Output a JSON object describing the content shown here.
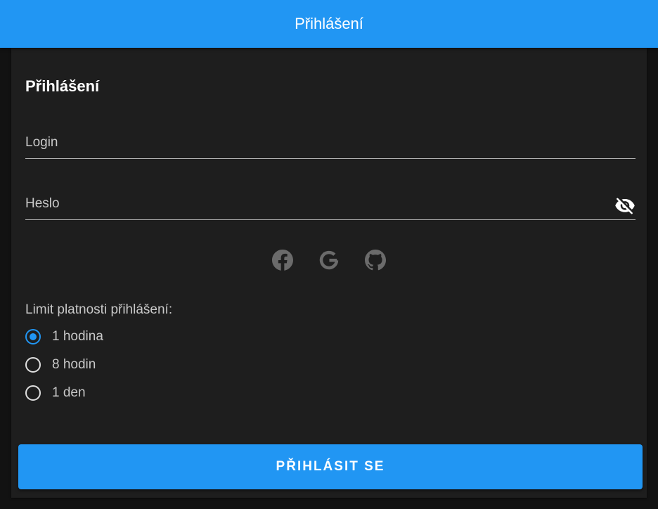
{
  "appbar": {
    "title": "Přihlášení"
  },
  "form": {
    "heading": "Přihlášení",
    "login": {
      "label": "Login",
      "value": ""
    },
    "password": {
      "label": "Heslo",
      "value": "",
      "toggle_icon": "eye-off-icon"
    },
    "social": [
      {
        "name": "facebook",
        "icon": "facebook-icon"
      },
      {
        "name": "google",
        "icon": "google-icon"
      },
      {
        "name": "github",
        "icon": "github-icon"
      }
    ],
    "limit": {
      "label": "Limit platnosti přihlášení:",
      "options": [
        "1 hodina",
        "8 hodin",
        "1 den"
      ],
      "selected": "1 hodina"
    },
    "submit_label": "PŘIHLÁSIT SE"
  },
  "colors": {
    "primary": "#2196f3",
    "background": "#121212",
    "surface": "#1e1e1e",
    "icon_muted": "#6b6b6b"
  }
}
